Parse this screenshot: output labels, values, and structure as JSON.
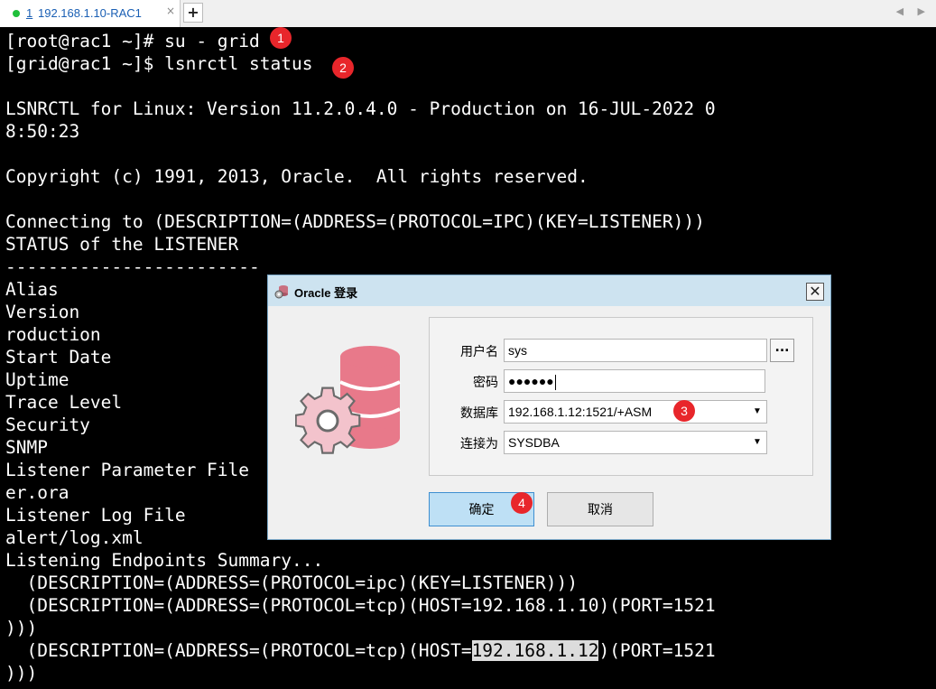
{
  "tab": {
    "number": "1",
    "title": "192.168.1.10-RAC1",
    "close": "×",
    "add": "+",
    "arrows": "◀ ▶"
  },
  "terminal": {
    "lines": [
      "[root@rac1 ~]# su - grid",
      "[grid@rac1 ~]$ lsnrctl status",
      "",
      "LSNRCTL for Linux: Version 11.2.0.4.0 - Production on 16-JUL-2022 0",
      "8:50:23",
      "",
      "Copyright (c) 1991, 2013, Oracle.  All rights reserved.",
      "",
      "Connecting to (DESCRIPTION=(ADDRESS=(PROTOCOL=IPC)(KEY=LISTENER)))",
      "STATUS of the LISTENER",
      "------------------------",
      "Alias",
      "Version",
      "roduction",
      "Start Date",
      "Uptime",
      "Trace Level",
      "Security",
      "SNMP",
      "Listener Parameter File",
      "er.ora",
      "Listener Log File",
      "alert/log.xml",
      "Listening Endpoints Summary...",
      "  (DESCRIPTION=(ADDRESS=(PROTOCOL=ipc)(KEY=LISTENER)))",
      "  (DESCRIPTION=(ADDRESS=(PROTOCOL=tcp)(HOST=192.168.1.10)(PORT=1521",
      ")))",
      "",
      ")))"
    ],
    "last_line_prefix": "  (DESCRIPTION=(ADDRESS=(PROTOCOL=tcp)(HOST=",
    "last_line_highlight": "192.168.1.12",
    "last_line_suffix": ")(PORT=1521"
  },
  "badges": [
    "1",
    "2",
    "3",
    "4"
  ],
  "dialog": {
    "title": "Oracle 登录",
    "close": "✕",
    "username_label": "用户名",
    "username_value": "sys",
    "browse_button": "...",
    "password_label": "密码",
    "password_value": "●●●●●●",
    "database_label": "数据库",
    "database_value": "192.168.1.12:1521/+ASM",
    "connect_as_label": "连接为",
    "connect_as_value": "SYSDBA",
    "dropdown_arrow": "▼",
    "ok_button": "确定",
    "cancel_button": "取消",
    "logo_colors": {
      "db": "#e8798a",
      "gear": "#f3c3cc",
      "outline": "#6b6b6b"
    }
  }
}
